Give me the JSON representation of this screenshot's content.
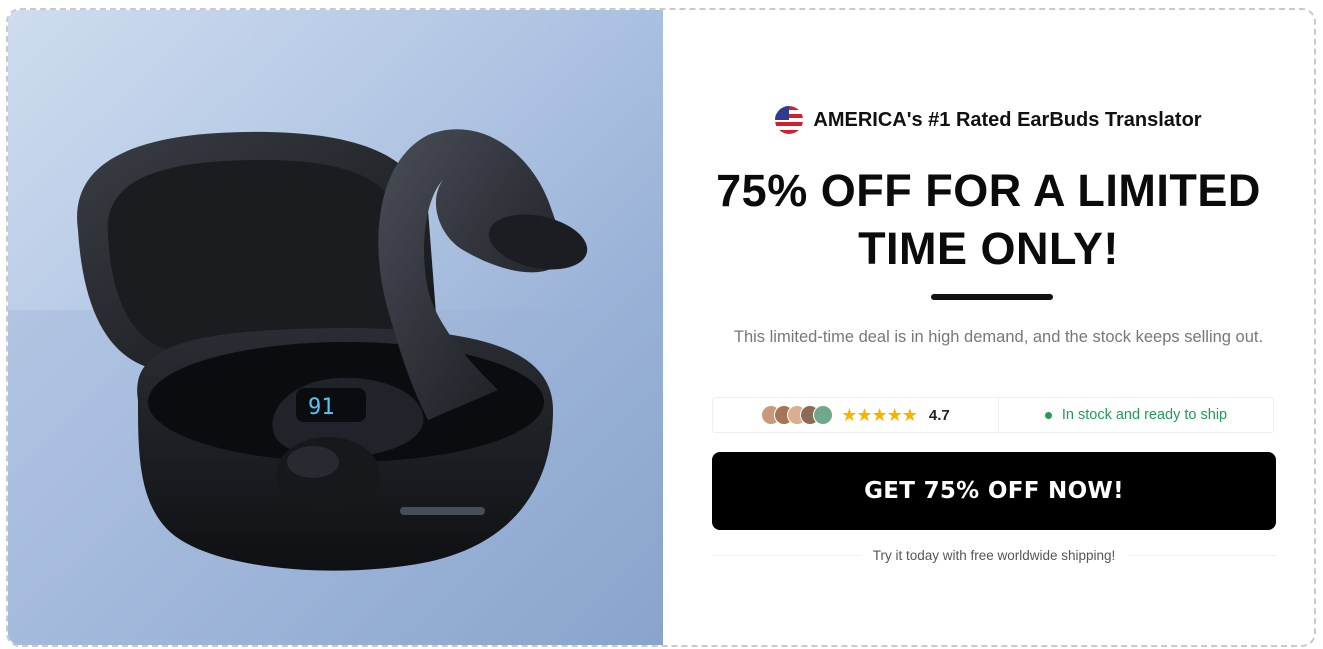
{
  "promo": {
    "eyebrow": "AMERICA's #1 Rated EarBuds Translator",
    "headline": "75% OFF FOR A LIMITED TIME ONLY!",
    "subtext": "This limited-time deal is in high demand, and the stock keeps selling out.",
    "rating_value": "4.7",
    "rating_stars": 4.7,
    "stock_status": "In stock and ready to ship",
    "cta_label": "GET 75% OFF NOW!",
    "footnote": "Try it today with free worldwide shipping!"
  },
  "icons": {
    "flag": "us-flag-icon",
    "stars": "star-rating-icon",
    "status": "green-dot-icon"
  },
  "colors": {
    "cta_background": "#000000",
    "stock_green": "#1f9d55",
    "star_gold": "#f4b400"
  }
}
